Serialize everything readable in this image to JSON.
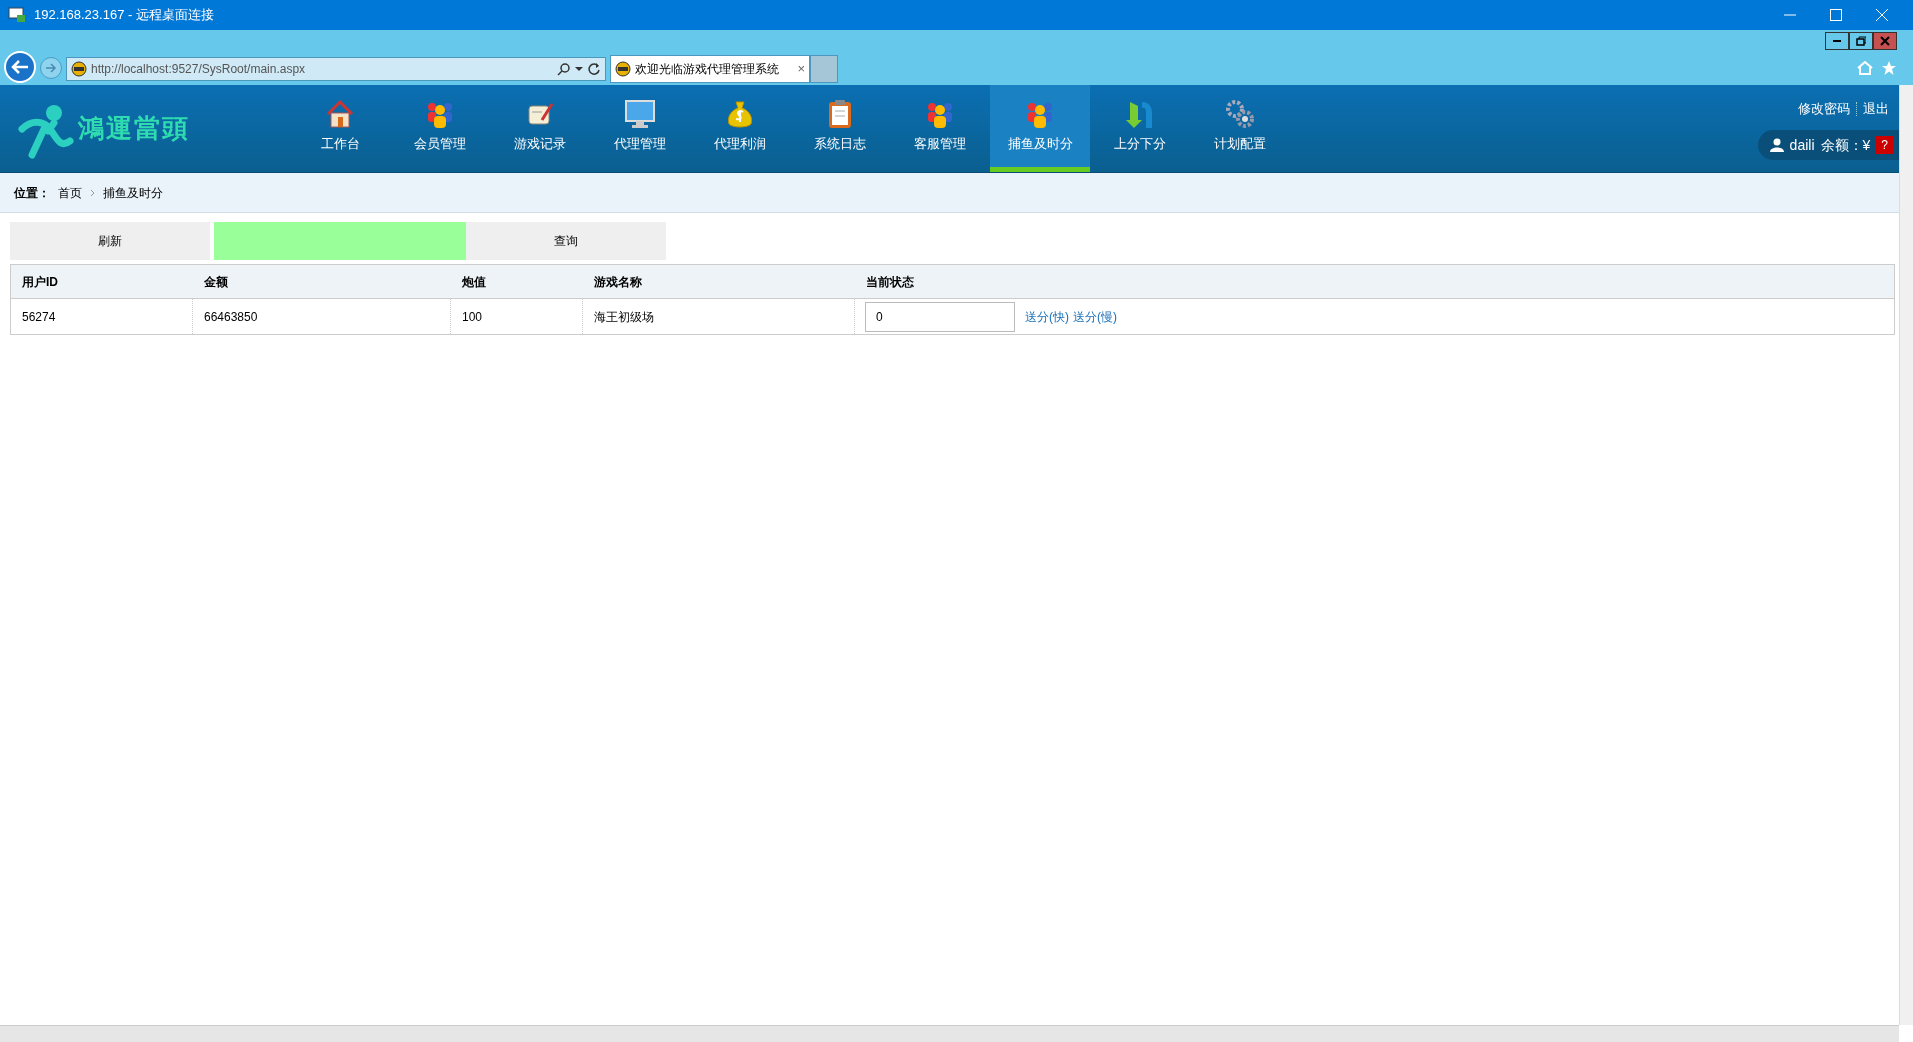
{
  "window": {
    "title": "192.168.23.167 - 远程桌面连接"
  },
  "browser": {
    "address": "http://localhost:9527/SysRoot/main.aspx",
    "tab_title": "欢迎光临游戏代理管理系统",
    "tab_close": "×"
  },
  "logo": {
    "text": "鴻運當頭"
  },
  "nav": [
    {
      "label": "工作台",
      "kind": "house",
      "selected": false
    },
    {
      "label": "会员管理",
      "kind": "people",
      "selected": false
    },
    {
      "label": "游戏记录",
      "kind": "scroll",
      "selected": false
    },
    {
      "label": "代理管理",
      "kind": "monitor",
      "selected": false
    },
    {
      "label": "代理利润",
      "kind": "moneybag",
      "selected": false
    },
    {
      "label": "系统日志",
      "kind": "clipboard",
      "selected": false
    },
    {
      "label": "客服管理",
      "kind": "people",
      "selected": false
    },
    {
      "label": "捕鱼及时分",
      "kind": "people",
      "selected": true
    },
    {
      "label": "上分下分",
      "kind": "arrows",
      "selected": false
    },
    {
      "label": "计划配置",
      "kind": "gears",
      "selected": false
    }
  ],
  "header_links": [
    "修改密码",
    "退出"
  ],
  "user": {
    "name": "daili",
    "balance_label": "余额：¥",
    "badge": "?"
  },
  "breadcrumb": {
    "label": "位置：",
    "items": [
      "首页",
      "捕鱼及时分"
    ]
  },
  "toolbar": {
    "refresh": "刷新",
    "query": "查询"
  },
  "table": {
    "columns": [
      "用户ID",
      "金额",
      "炮值",
      "游戏名称",
      "当前状态"
    ],
    "rows": [
      {
        "user_id": "56274",
        "amount": "66463850",
        "cannon": "100",
        "game": "海王初级场",
        "status_value": "0",
        "links": [
          "送分(快)",
          "送分(慢)"
        ]
      }
    ]
  }
}
